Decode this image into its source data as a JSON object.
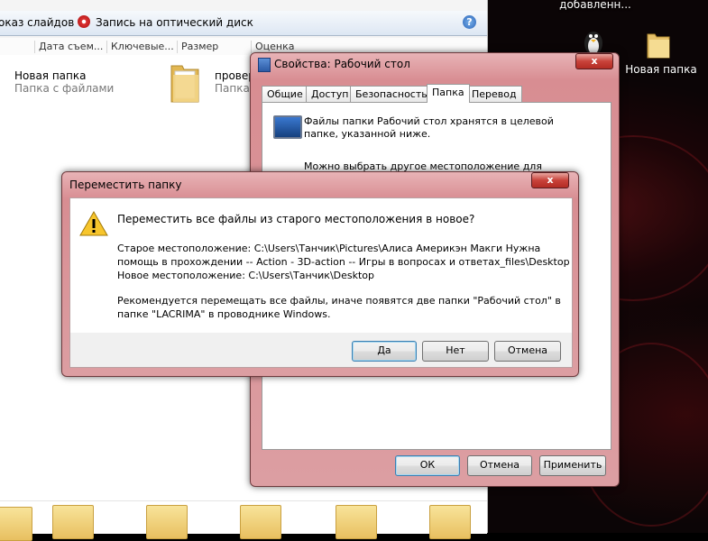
{
  "explorer": {
    "toolbar": {
      "slideshow_label": "оказ слайдов",
      "burn_label": "Запись на оптический диск"
    },
    "columns": [
      "Дата съем...",
      "Ключевые...",
      "Размер",
      "Оценка"
    ],
    "items": [
      {
        "name": "Новая папка",
        "sub": "Папка с файлами"
      },
      {
        "name": "провер",
        "sub": "Папка с"
      }
    ]
  },
  "desktop": {
    "top_label": "добавленн...",
    "folder_label": "Новая папка"
  },
  "properties": {
    "title": "Свойства: Рабочий стол",
    "tabs": [
      "Общие",
      "Доступ",
      "Безопасность",
      "Папка",
      "Перевод"
    ],
    "active_tab": "Папка",
    "info_text": "Файлы папки Рабочий стол хранятся в целевой папке, указанной ниже.",
    "info_text2": "Можно выбрать другое местоположение для хранения",
    "buttons": {
      "ok": "ОК",
      "cancel": "Отмена",
      "apply": "Применить"
    }
  },
  "dialog": {
    "title": "Переместить папку",
    "close_label": "x",
    "question": "Переместить все файлы из старого местоположения в новое?",
    "old_line1": "Старое местоположение: C:\\Users\\Танчик\\Pictures\\Алиса Америкэн Макги Нужна",
    "old_line2": "помощь в прохождении -- Action - 3D-action -- Игры в вопросах и ответах_files\\Desktop",
    "new_line": "Новое местоположение: C:\\Users\\Танчик\\Desktop",
    "recommend_line1": "Рекомендуется перемещать все файлы, иначе появятся две папки \"Рабочий стол\" в",
    "recommend_line2": "папке \"LACRIMA\" в проводнике Windows.",
    "buttons": {
      "yes": "Да",
      "no": "Нет",
      "cancel": "Отмена"
    }
  }
}
